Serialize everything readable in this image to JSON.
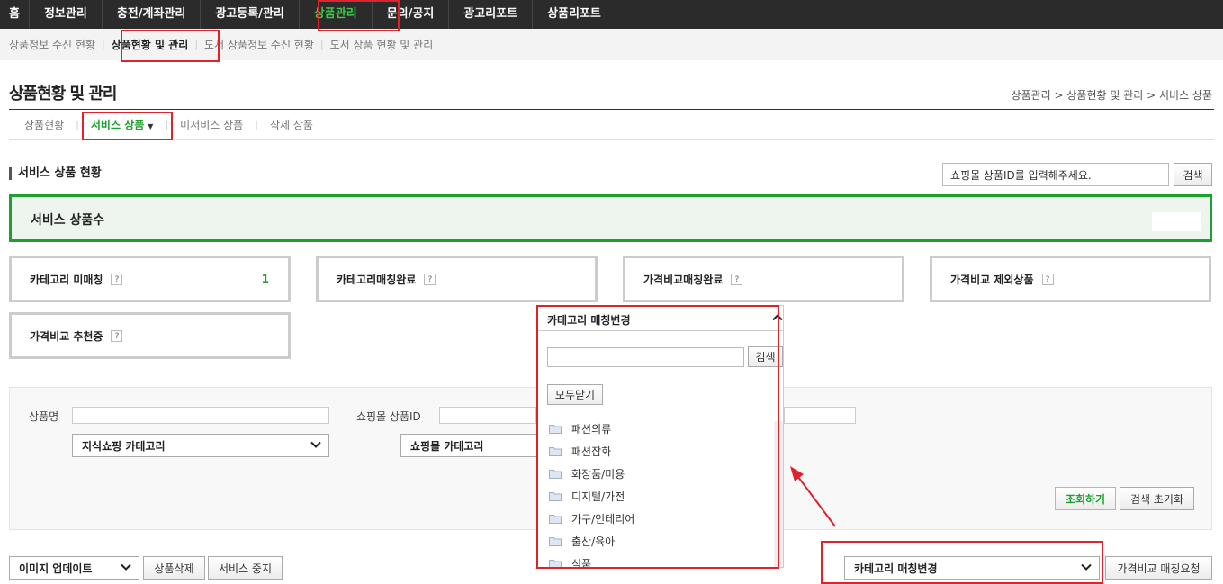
{
  "topnav": {
    "items": [
      {
        "label": "홈"
      },
      {
        "label": "정보관리"
      },
      {
        "label": "충전/계좌관리"
      },
      {
        "label": "광고등록/관리"
      },
      {
        "label": "상품관리"
      },
      {
        "label": "문의/공지"
      },
      {
        "label": "광고리포트"
      },
      {
        "label": "상품리포트"
      }
    ],
    "active_color": "#3ec94c"
  },
  "subnav": {
    "items": [
      {
        "label": "상품정보 수신 현황"
      },
      {
        "label": "상품현황 및 관리"
      },
      {
        "label": "도서 상품정보 수신 현황"
      },
      {
        "label": "도서 상품 현황 및 관리"
      }
    ]
  },
  "page": {
    "title": "상품현황 및 관리",
    "breadcrumb": "상품관리 > 상품현황 및 관리 > 서비스 상품"
  },
  "tabs": {
    "items": [
      {
        "label": "상품현황"
      },
      {
        "label": "서비스 상품"
      },
      {
        "label": "미서비스 상품"
      },
      {
        "label": "삭제 상품"
      }
    ]
  },
  "status": {
    "section_title": "서비스 상품 현황",
    "search_value": "쇼핑몰 상품ID를 입력해주세요.",
    "search_button": "검색",
    "service_count_label": "서비스 상품수",
    "cards": [
      {
        "label": "카테고리 미매칭",
        "help": "?",
        "count": "1"
      },
      {
        "label": "카테고리매칭완료",
        "help": "?"
      },
      {
        "label": "가격비교매칭완료",
        "help": "?"
      },
      {
        "label": "가격비교 제외상품",
        "help": "?"
      },
      {
        "label": "가격비교 추천중",
        "help": "?"
      }
    ]
  },
  "filter": {
    "product_name_label": "상품명",
    "mall_product_id_label": "쇼핑몰 상품ID",
    "jisik_category": "지식쇼핑 카테고리",
    "mall_category": "쇼핑몰 카테고리",
    "search_button": "조회하기",
    "reset_button": "검색 초기화"
  },
  "popup": {
    "title": "카테고리 매칭변경",
    "search_button": "검색",
    "close_all_button": "모두닫기",
    "tree_items": [
      {
        "label": "패션의류"
      },
      {
        "label": "패션잡화"
      },
      {
        "label": "화장품/미용"
      },
      {
        "label": "디지털/가전"
      },
      {
        "label": "가구/인테리어"
      },
      {
        "label": "출산/육아"
      },
      {
        "label": "식품"
      }
    ]
  },
  "bottom": {
    "image_update": "이미지 업데이트",
    "delete_button": "상품삭제",
    "stop_button": "서비스 중지",
    "category_change": "카테고리 매칭변경",
    "compare_request_button": "가격비교 매칭요청"
  },
  "colors": {
    "nav_bg": "#2b2b2b",
    "accent_green": "#1ca030",
    "highlight_red": "#e0222a"
  }
}
